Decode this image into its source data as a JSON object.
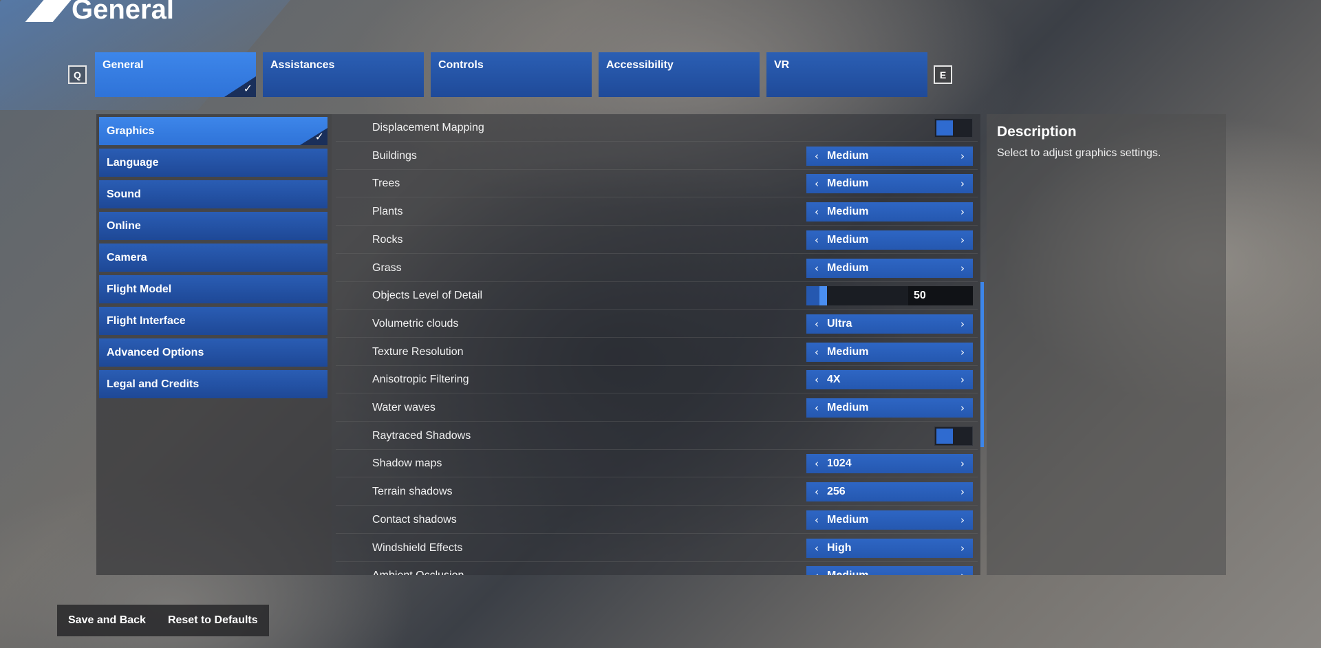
{
  "header": {
    "title": "General",
    "key_left": "Q",
    "key_right": "E"
  },
  "tabs": [
    {
      "label": "General",
      "active": true
    },
    {
      "label": "Assistances"
    },
    {
      "label": "Controls"
    },
    {
      "label": "Accessibility"
    },
    {
      "label": "VR"
    }
  ],
  "sidebar": {
    "items": [
      {
        "label": "Graphics",
        "active": true
      },
      {
        "label": "Language"
      },
      {
        "label": "Sound"
      },
      {
        "label": "Online"
      },
      {
        "label": "Camera"
      },
      {
        "label": "Flight Model"
      },
      {
        "label": "Flight Interface"
      },
      {
        "label": "Advanced Options"
      },
      {
        "label": "Legal and Credits"
      }
    ]
  },
  "settings": [
    {
      "label": "Displacement Mapping",
      "type": "toggle",
      "on": false
    },
    {
      "label": "Buildings",
      "type": "select",
      "value": "Medium"
    },
    {
      "label": "Trees",
      "type": "select",
      "value": "Medium"
    },
    {
      "label": "Plants",
      "type": "select",
      "value": "Medium"
    },
    {
      "label": "Rocks",
      "type": "select",
      "value": "Medium"
    },
    {
      "label": "Grass",
      "type": "select",
      "value": "Medium"
    },
    {
      "label": "Objects Level of Detail",
      "type": "slider",
      "value": "50"
    },
    {
      "label": "Volumetric clouds",
      "type": "select",
      "value": "Ultra"
    },
    {
      "label": "Texture Resolution",
      "type": "select",
      "value": "Medium"
    },
    {
      "label": "Anisotropic Filtering",
      "type": "select",
      "value": "4X"
    },
    {
      "label": "Water waves",
      "type": "select",
      "value": "Medium"
    },
    {
      "label": "Raytraced Shadows",
      "type": "toggle",
      "on": false
    },
    {
      "label": "Shadow maps",
      "type": "select",
      "value": "1024"
    },
    {
      "label": "Terrain shadows",
      "type": "select",
      "value": "256"
    },
    {
      "label": "Contact shadows",
      "type": "select",
      "value": "Medium"
    },
    {
      "label": "Windshield Effects",
      "type": "select",
      "value": "High"
    },
    {
      "label": "Ambient Occlusion",
      "type": "select",
      "value": "Medium"
    }
  ],
  "description": {
    "title": "Description",
    "text": "Select to adjust graphics settings."
  },
  "footer": {
    "save_label": "Save and Back",
    "reset_label": "Reset to Defaults"
  },
  "icons": {
    "check": "checkmark-icon",
    "left": "chevron-left-icon",
    "right": "chevron-right-icon"
  },
  "colors": {
    "accent": "#3d86ea",
    "tab": "#2558b0",
    "track": "#1a1d23"
  }
}
